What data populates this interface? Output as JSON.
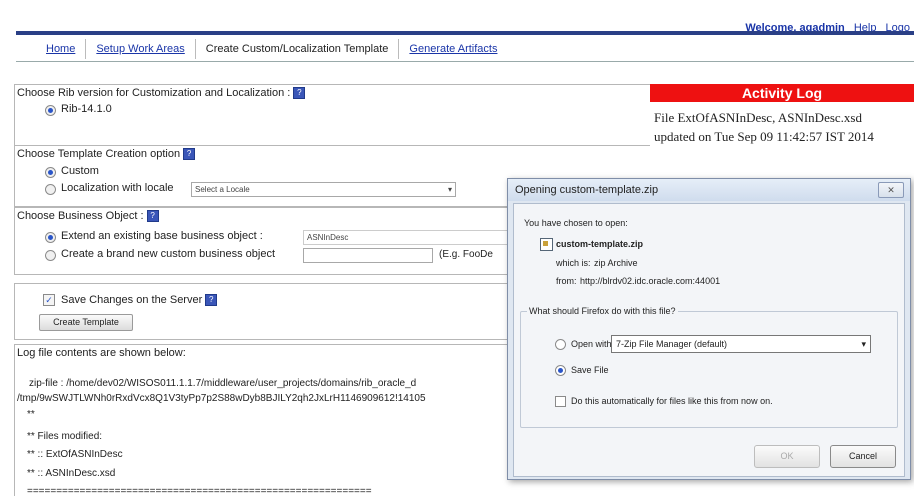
{
  "header": {
    "welcome": "Welcome, agadmin",
    "help": "Help",
    "logout": "Logo"
  },
  "tabs": [
    {
      "label": "Home",
      "active": false
    },
    {
      "label": "Setup Work Areas",
      "active": false
    },
    {
      "label": "Create Custom/Localization Template",
      "active": true
    },
    {
      "label": "Generate Artifacts",
      "active": false
    }
  ],
  "rib_section": {
    "title": "Choose Rib version for Customization and Localization :",
    "option": "Rib-14.1.0"
  },
  "template_section": {
    "title": "Choose Template Creation option",
    "custom": "Custom",
    "localization": "Localization with locale",
    "locale_placeholder": "Select a Locale"
  },
  "business_section": {
    "title": "Choose Business Object :",
    "extend_label": "Extend an existing base business object :",
    "extend_value": "ASNInDesc",
    "create_label": "Create a brand new custom business object",
    "example": "(E.g. FooDe"
  },
  "save_section": {
    "checkbox_label": "Save Changes on the Server",
    "button": "Create Template"
  },
  "log": {
    "title": "Log file contents are shown below:",
    "lines": [
      "zip-file : /home/dev02/WISOS011.1.1.7/middleware/user_projects/domains/rib_oracle_d",
      "/tmp/9wSWJTLWNh0rRxdVcx8Q1V3tyPp7p2S88wDyb8BJILY2qh2JxLrH1146909612!14105",
      "**",
      "** Files modified:",
      "** :: ExtOfASNInDesc",
      "** :: ASNInDesc.xsd",
      "==========================================================="
    ]
  },
  "activity_log": {
    "title": "Activity Log",
    "text": "File ExtOfASNInDesc, ASNInDesc.xsd updated on Tue Sep 09 11:42:57 IST 2014"
  },
  "dialog": {
    "title": "Opening custom-template.zip",
    "intro": "You have chosen to open:",
    "filename": "custom-template.zip",
    "which_is_label": "which is:",
    "which_is_value": "zip Archive",
    "from_label": "from:",
    "from_value": "http://blrdv02.idc.oracle.com:44001",
    "question": "What should Firefox do with this file?",
    "open_with_label": "Open with",
    "open_with_value": "7-Zip File Manager (default)",
    "save_file_label": "Save File",
    "auto_label": "Do this automatically for files like this from now on.",
    "ok": "OK",
    "cancel": "Cancel",
    "close": "✕"
  }
}
